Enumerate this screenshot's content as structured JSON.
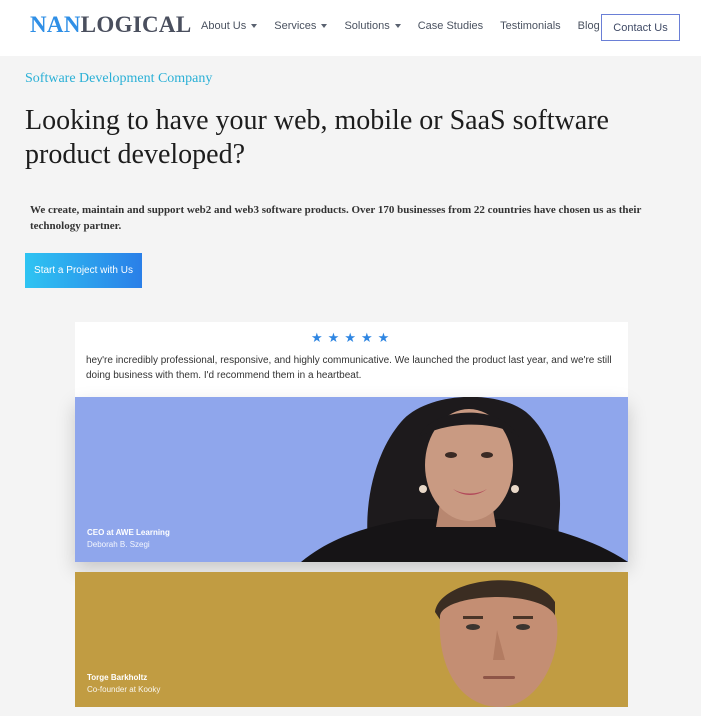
{
  "header": {
    "logo_part1": "NAN",
    "logo_part2": "LOGICAL",
    "nav": [
      {
        "label": "About Us",
        "has_dropdown": true
      },
      {
        "label": "Services",
        "has_dropdown": true
      },
      {
        "label": "Solutions",
        "has_dropdown": true
      },
      {
        "label": "Case Studies",
        "has_dropdown": false
      },
      {
        "label": "Testimonials",
        "has_dropdown": false
      },
      {
        "label": "Blog",
        "has_dropdown": false
      }
    ],
    "contact_label": "Contact Us"
  },
  "hero": {
    "eyebrow": "Software Development Company",
    "headline": "Looking to have your web, mobile or SaaS software product developed?",
    "lead": "We create, maintain and support web2 and web3 software products. Over 170 businesses from 22 countries have chosen us as their technology partner.",
    "cta_label": "Start a Project with Us"
  },
  "testimonial": {
    "rating": 5,
    "quote": "hey're incredibly professional, responsive, and highly communicative. We launched the product last year, and we're still doing business with them. I'd recommend them in a heartbeat."
  },
  "people": [
    {
      "title": "CEO at AWE Learning",
      "name": "Deborah B. Szegi"
    },
    {
      "title": "Torge Barkholtz",
      "name": "Co-founder at Kooky"
    }
  ],
  "colors": {
    "accent_blue": "#2f8fe6",
    "card1_bg": "#8fa6ec",
    "card2_bg": "#c19c42",
    "star": "#2f86e2"
  }
}
